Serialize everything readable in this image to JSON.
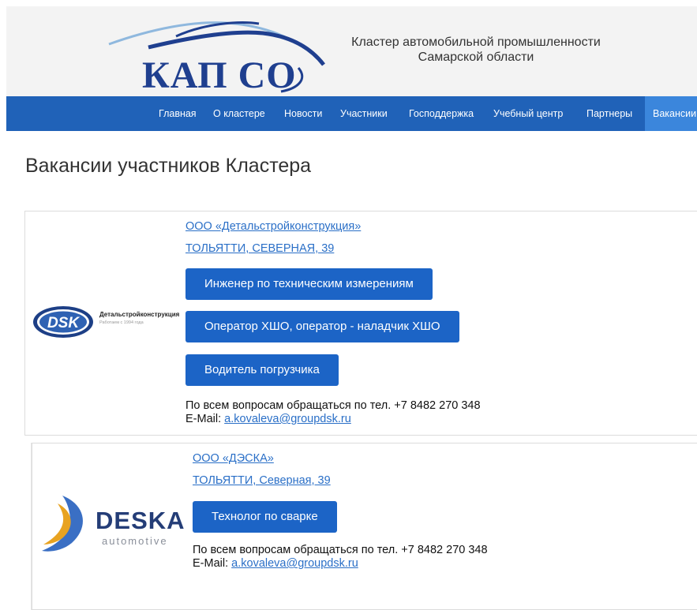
{
  "header": {
    "logo_text": "КАП СО",
    "title_line1": "Кластер автомобильной промышленности",
    "title_line2": "Самарской области"
  },
  "nav": {
    "items": [
      {
        "label": "Главная"
      },
      {
        "label": "О кластере"
      },
      {
        "label": "Новости"
      },
      {
        "label": "Участники"
      },
      {
        "label": "Господдержка"
      },
      {
        "label": "Учебный центр"
      },
      {
        "label": "Партнеры"
      },
      {
        "label": "Вакансии"
      }
    ],
    "active_index": 7
  },
  "page": {
    "title": "Вакансии участников Кластера"
  },
  "companies": [
    {
      "name": "ООО «Детальстройконструкция»",
      "address": "ТОЛЬЯТТИ, СЕВЕРНАЯ, 39",
      "logo": {
        "mark": "DSK",
        "name": "Детальстройконструкция",
        "sub": "Работаем с 1994 года"
      },
      "vacancies": [
        "Инженер по техническим измерениям",
        "Оператор ХШО, оператор - наладчик ХШО",
        "Водитель погрузчика"
      ],
      "contact_phone": "По всем вопросам обращаться по тел. +7 8482 270 348",
      "contact_email_label": "E-Mail:",
      "contact_email": "a.kovaleva@groupdsk.ru"
    },
    {
      "name": "ООО «ДЭСКА»",
      "address": "ТОЛЬЯТТИ, Северная, 39",
      "logo": {
        "name": "DESKA",
        "sub": "automotive"
      },
      "vacancies": [
        "Технолог по сварке"
      ],
      "contact_phone": "По всем вопросам обращаться по тел. +7 8482 270 348",
      "contact_email_label": "E-Mail:",
      "contact_email": "a.kovaleva@groupdsk.ru"
    }
  ],
  "colors": {
    "nav_bg": "#2062b8",
    "nav_active_bg": "#3b86dc",
    "button_bg": "#1c64c6",
    "link": "#2a6fc7",
    "brand_dark": "#1f3f8f"
  }
}
